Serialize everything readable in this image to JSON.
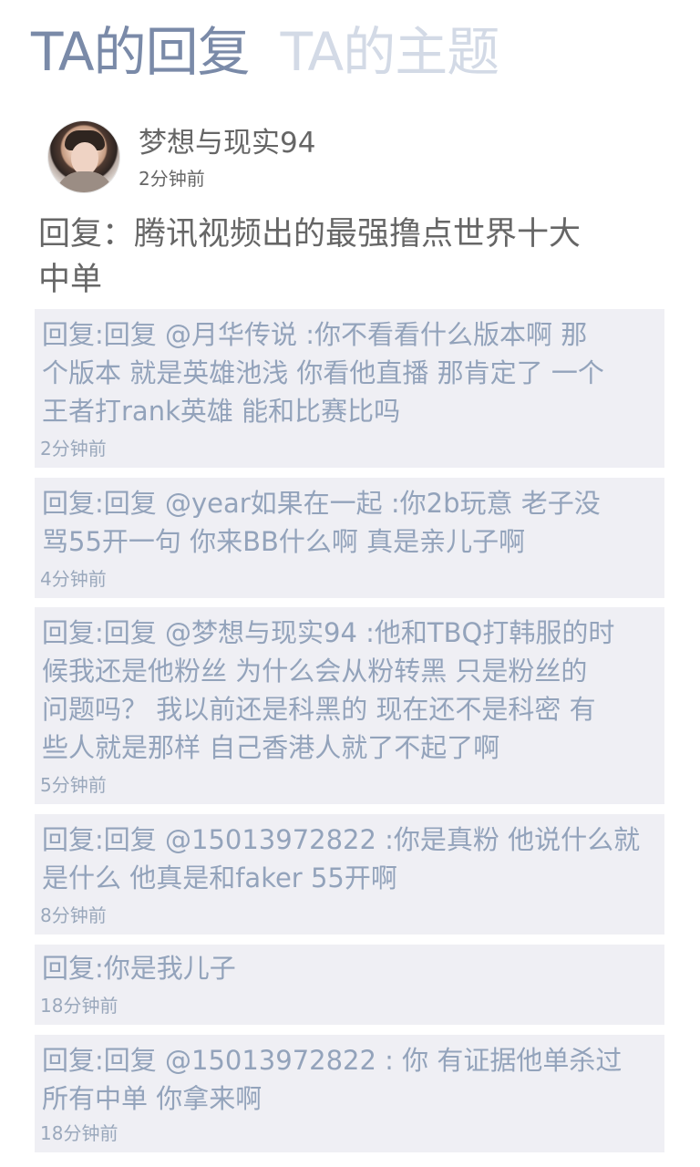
{
  "tabs": {
    "replies": "TA的回复",
    "topics": "TA的主题"
  },
  "profile": {
    "username": "梦想与现实94",
    "time": "2分钟前"
  },
  "thread": {
    "title": "回复：腾讯视频出的最强撸点世界十大\n中单"
  },
  "replies": [
    {
      "text": "回复:回复 @月华传说 :你不看看什么版本啊 那\n个版本 就是英雄池浅 你看他直播 那肯定了 一个\n王者打rank英雄 能和比赛比吗",
      "time": "2分钟前"
    },
    {
      "text": "回复:回复 @year如果在一起 :你2b玩意 老子没\n骂55开一句 你来BB什么啊 真是亲儿子啊",
      "time": "4分钟前"
    },
    {
      "text": "回复:回复 @梦想与现实94 :他和TBQ打韩服的时\n候我还是他粉丝 为什么会从粉转黑 只是粉丝的\n问题吗？ 我以前还是科黑的 现在还不是科密 有\n些人就是那样 自己香港人就了不起了啊",
      "time": "5分钟前"
    },
    {
      "text": "回复:回复 @15013972822 :你是真粉 他说什么就\n是什么 他真是和faker 55开啊",
      "time": "8分钟前"
    },
    {
      "text": "回复:你是我儿子",
      "time": "18分钟前"
    },
    {
      "text": "回复:回复 @15013972822 : 你 有证据他单杀过\n所有中单 你拿来啊",
      "time": "18分钟前"
    }
  ]
}
